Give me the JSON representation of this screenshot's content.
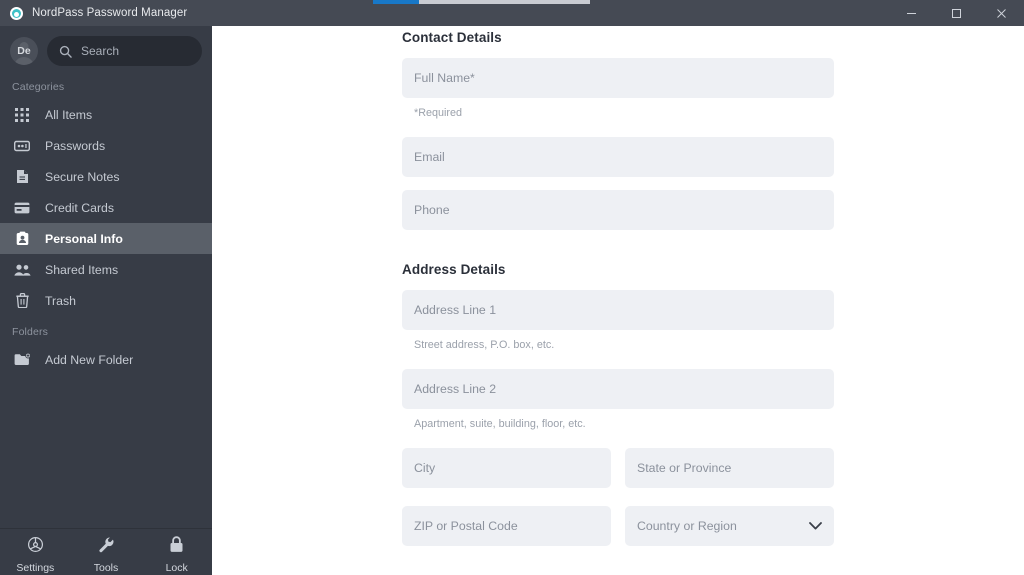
{
  "window": {
    "title": "NordPass Password Manager",
    "logo_icon": "nordpass-logo-icon",
    "controls": {
      "minimize": "minimize-icon",
      "maximize": "maximize-icon",
      "close": "close-icon"
    }
  },
  "progress": {
    "value": 21,
    "fill_color": "#1878c8",
    "track_color": "#c9ccd2"
  },
  "sidebar": {
    "avatar_initials": "De",
    "search": {
      "placeholder": "Search",
      "icon": "search-icon"
    },
    "categories_label": "Categories",
    "categories": [
      {
        "label": "All Items",
        "icon": "grid-icon",
        "active": false
      },
      {
        "label": "Passwords",
        "icon": "password-icon",
        "active": false
      },
      {
        "label": "Secure Notes",
        "icon": "note-icon",
        "active": false
      },
      {
        "label": "Credit Cards",
        "icon": "credit-card-icon",
        "active": false
      },
      {
        "label": "Personal Info",
        "icon": "id-card-icon",
        "active": true
      },
      {
        "label": "Shared Items",
        "icon": "people-icon",
        "active": false
      },
      {
        "label": "Trash",
        "icon": "trash-icon",
        "active": false
      }
    ],
    "folders_label": "Folders",
    "folders": [
      {
        "label": "Add New Folder",
        "icon": "add-folder-icon"
      }
    ],
    "footer": [
      {
        "label": "Settings",
        "icon": "gear-icon"
      },
      {
        "label": "Tools",
        "icon": "wrench-icon"
      },
      {
        "label": "Lock",
        "icon": "lock-icon"
      }
    ]
  },
  "main": {
    "contact": {
      "title": "Contact Details",
      "full_name": {
        "placeholder": "Full Name*",
        "value": ""
      },
      "required_note": "*Required",
      "email": {
        "placeholder": "Email",
        "value": ""
      },
      "phone": {
        "placeholder": "Phone",
        "value": ""
      }
    },
    "address": {
      "title": "Address Details",
      "line1": {
        "placeholder": "Address Line 1",
        "value": ""
      },
      "line1_helper": "Street address, P.O. box, etc.",
      "line2": {
        "placeholder": "Address Line 2",
        "value": ""
      },
      "line2_helper": "Apartment, suite, building, floor, etc.",
      "city": {
        "placeholder": "City",
        "value": ""
      },
      "state": {
        "placeholder": "State or Province",
        "value": ""
      },
      "zip": {
        "placeholder": "ZIP or Postal Code",
        "value": ""
      },
      "country": {
        "placeholder": "Country or Region",
        "value": "",
        "icon": "chevron-down-icon"
      }
    }
  }
}
